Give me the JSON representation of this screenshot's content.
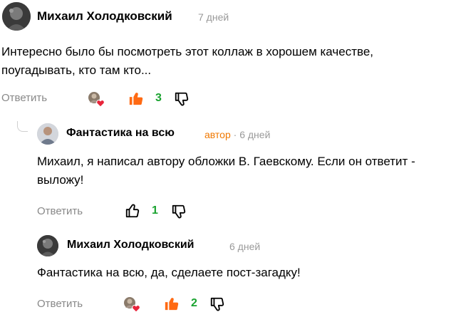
{
  "comments": [
    {
      "author": "Михаил Холодковский",
      "time": "7 дней",
      "text": "Интересно было бы посмотреть этот коллаж в хорошем качестве, поугадывать, кто там кто...",
      "reply_label": "Ответить",
      "likes": "3"
    },
    {
      "author": "Фантастика на всю",
      "badge": "автор",
      "time_sep": " · ",
      "time": "6 дней",
      "text": "Михаил, я написал автору обложки В. Гаевскому. Если он ответит - выложу!",
      "reply_label": "Ответить",
      "likes": "1"
    },
    {
      "author": "Михаил Холодковский",
      "time": "6 дней",
      "text": "Фантастика на всю, да, сделаете пост-загадку!",
      "reply_label": "Ответить",
      "likes": "2"
    }
  ],
  "colors": {
    "accent_orange": "#f07800",
    "like_count_green": "#1aa330",
    "meta_gray": "#999999"
  },
  "icons": [
    "avatar",
    "reactors-avatar",
    "heart-icon",
    "thumbs-up-icon",
    "thumbs-down-icon",
    "thread-line"
  ]
}
